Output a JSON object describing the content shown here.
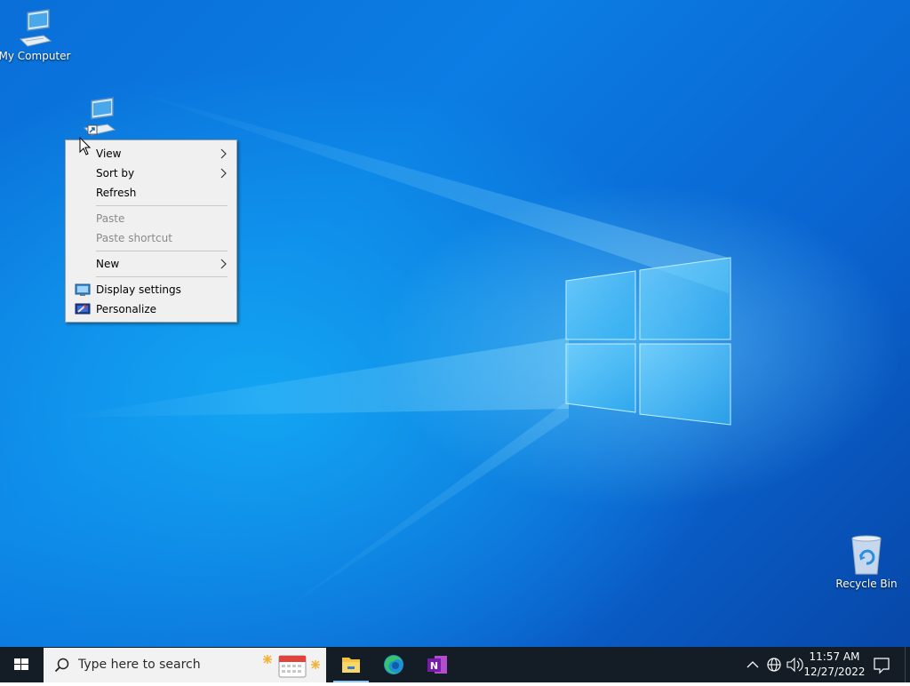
{
  "desktop": {
    "icons": [
      {
        "label": "My Computer",
        "icon": "computer-icon"
      },
      {
        "label": "",
        "icon": "computer-shortcut-icon"
      },
      {
        "label": "Recycle Bin",
        "icon": "recycle-bin-icon"
      }
    ]
  },
  "context_menu": {
    "items": [
      {
        "label": "View",
        "submenu": true,
        "enabled": true
      },
      {
        "label": "Sort by",
        "submenu": true,
        "enabled": true
      },
      {
        "label": "Refresh",
        "submenu": false,
        "enabled": true
      },
      {
        "label": "Paste",
        "submenu": false,
        "enabled": false
      },
      {
        "label": "Paste shortcut",
        "submenu": false,
        "enabled": false
      },
      {
        "label": "New",
        "submenu": true,
        "enabled": true
      },
      {
        "label": "Display settings",
        "submenu": false,
        "enabled": true,
        "icon": "display-settings-icon"
      },
      {
        "label": "Personalize",
        "submenu": false,
        "enabled": true,
        "icon": "personalize-icon"
      }
    ]
  },
  "taskbar": {
    "search_placeholder": "Type here to search",
    "apps": [
      {
        "name": "File Explorer",
        "icon": "file-explorer-icon",
        "active": true
      },
      {
        "name": "Microsoft Edge",
        "icon": "edge-icon",
        "active": false
      },
      {
        "name": "OneNote",
        "icon": "onenote-icon",
        "active": false
      }
    ],
    "clock": {
      "time": "11:57 AM",
      "date": "12/27/2022"
    }
  },
  "colors": {
    "taskbar_bg": "#141c26",
    "menu_bg": "#f0f0f0",
    "accent": "#0a6fd8"
  }
}
